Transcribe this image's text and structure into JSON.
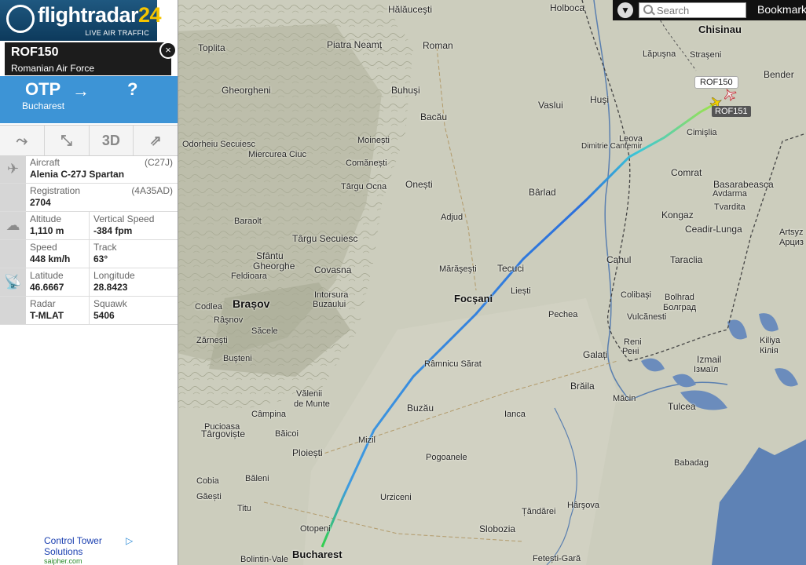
{
  "app": {
    "brand": "flightradar24",
    "brand_num": "24",
    "brand_text": "flightradar",
    "tagline": "LIVE AIR TRAFFIC"
  },
  "topbar": {
    "search_placeholder": "Search",
    "bookmarks_label": "Bookmark"
  },
  "flight": {
    "callsign": "ROF150",
    "operator": "Romanian Air Force",
    "from_code": "OTP",
    "from_city": "Bucharest",
    "to_code": "?",
    "close_glyph": "×",
    "arrow_glyph": "→"
  },
  "toolbar": {
    "three_d_label": "3D"
  },
  "details": {
    "aircraft_label": "Aircraft",
    "aircraft_code": "(C27J)",
    "aircraft_value": "Alenia C-27J Spartan",
    "registration_label": "Registration",
    "registration_code": "(4A35AD)",
    "registration_value": "2704",
    "altitude_label": "Altitude",
    "altitude_value": "1,110 m",
    "vspeed_label": "Vertical Speed",
    "vspeed_value": "-384 fpm",
    "speed_label": "Speed",
    "speed_value": "448 km/h",
    "track_label": "Track",
    "track_value": "63°",
    "lat_label": "Latitude",
    "lat_value": "46.6667",
    "lon_label": "Longitude",
    "lon_value": "28.8423",
    "radar_label": "Radar",
    "radar_value": "T-MLAT",
    "squawk_label": "Squawk",
    "squawk_value": "5406"
  },
  "ad": {
    "line1": "Control Tower",
    "line2": "Solutions",
    "url": "saipher.com"
  },
  "map": {
    "tag_primary": "ROF150",
    "tag_secondary": "ROF151",
    "cities": {
      "halaucesti": "Hălăuceşti",
      "holboca": "Holboca",
      "chisinau": "Chisinau",
      "toplita": "Toplita",
      "piatra": "Piatra Neamț",
      "roman": "Roman",
      "lapusna": "Lăpuşna",
      "straseni": "Straşeni",
      "bender": "Bender",
      "gheorgheni": "Gheorgheni",
      "buhusi": "Buhuşi",
      "bacau": "Bacău",
      "vaslui": "Vaslui",
      "husi": "Huşi",
      "cimislia": "Cimişlia",
      "odorheiu": "Odorheiu Secuiesc",
      "miercurea": "Miercurea Ciuc",
      "moinesti": "Moinești",
      "comanesti": "Comănești",
      "targuocna": "Târgu Ocna",
      "onesti": "Onești",
      "dimitrie": "Dimitrie Cantemir",
      "leova": "Leova",
      "comrat": "Comrat",
      "basarabeasca": "Basarabeasca",
      "avdarma": "Avdarma",
      "barlad": "Bârlad",
      "tvardita": "Tvardita",
      "kongaz": "Kongaz",
      "adjud": "Adjud",
      "baraolt": "Baraolt",
      "targusec": "Târgu Secuiesc",
      "ceadir": "Ceadir-Lunga",
      "artsyz1": "Artsyz",
      "artsyz2": "Арциз",
      "sfantu1": "Sfântu",
      "sfantu2": "Gheorghe",
      "covasna": "Covasna",
      "marasesti": "Mărăşeşti",
      "tecuci": "Tecuci",
      "cahul": "Cahul",
      "taraclia": "Taraclia",
      "feldioara": "Feldioara",
      "intorsura1": "Intorsura",
      "intorsura2": "Buzaului",
      "liesti": "Liești",
      "codlea": "Codlea",
      "brasov": "Brașov",
      "focsani": "Focşani",
      "colibasi": "Colibaşi",
      "bolhrad1": "Bolhrad",
      "bolhrad2": "Болград",
      "rasnov": "Râşnov",
      "pechea": "Pechea",
      "vulcanesti": "Vulcănesti",
      "sacele": "Săcele",
      "zarnesti": "Zărnești",
      "reni1": "Reni",
      "reni2": "Рені",
      "kiliya1": "Kiliya",
      "kiliya2": "Кілія",
      "ramnicu": "Râmnicu Sărat",
      "busteni": "Buşteni",
      "galati": "Galați",
      "izmail1": "Izmail",
      "izmail2": "Ізмаїл",
      "braila": "Brăila",
      "valenii1": "Vălenii",
      "valenii2": "de Munte",
      "buzau": "Buzău",
      "macin": "Măcin",
      "tulcea": "Tulcea",
      "campina": "Câmpina",
      "ianca": "Ianca",
      "pucioasa": "Pucioasa",
      "baicoi": "Băicoi",
      "targoviste": "Târgoviște",
      "ploiesti": "Ploiești",
      "mizil": "Mizil",
      "pogoanele": "Pogoanele",
      "babadag": "Babadag",
      "cobia": "Cobia",
      "baleni": "Băleni",
      "gaesti": "Găești",
      "urziceni": "Urziceni",
      "harsova": "Hârşova",
      "titu": "Titu",
      "tandarei": "Țăndărei",
      "otopeni": "Otopeni",
      "slobozia": "Slobozia",
      "bucharest": "Bucharest",
      "bolintin": "Bolintin-Vale",
      "fetesti": "Fetești-Gară"
    }
  }
}
